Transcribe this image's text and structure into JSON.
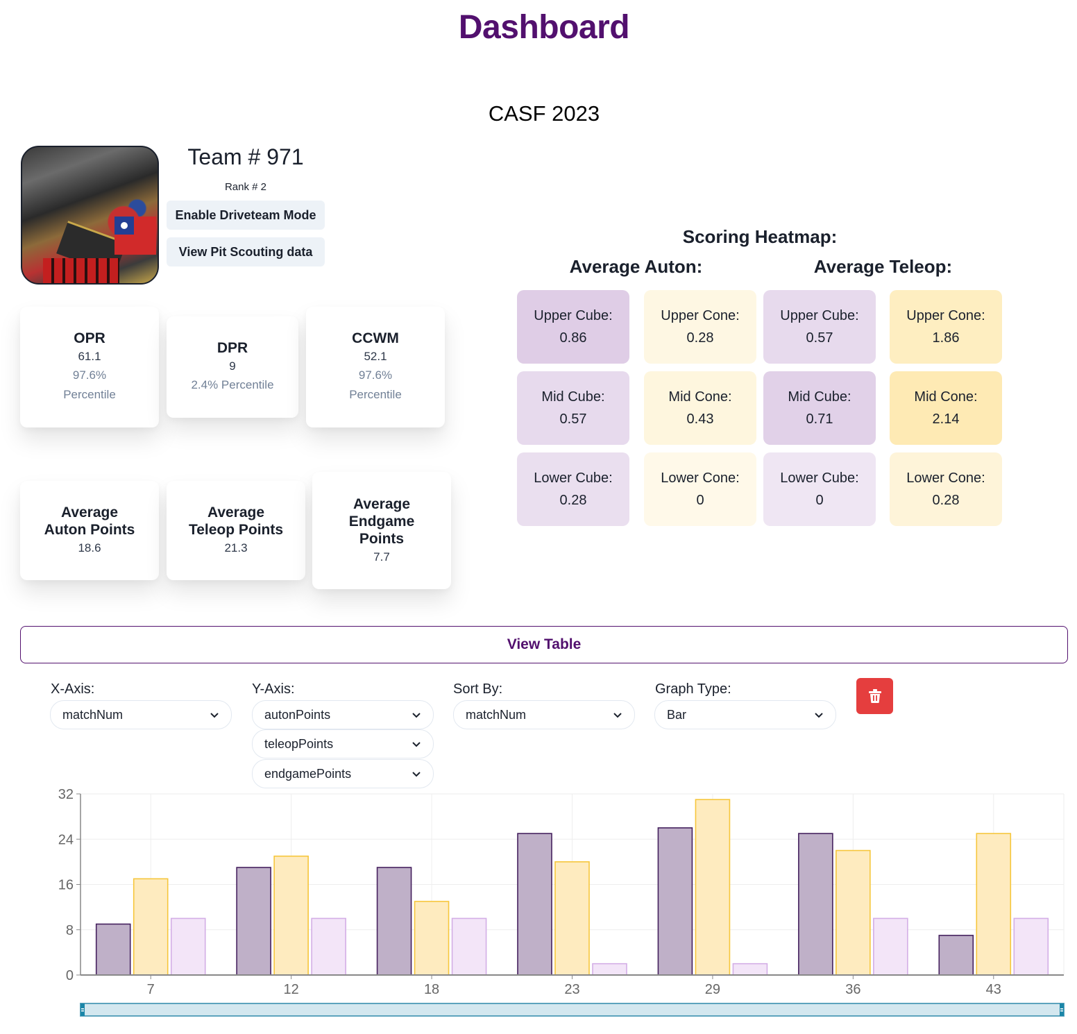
{
  "page": {
    "title": "Dashboard",
    "event": "CASF 2023"
  },
  "team": {
    "title": "Team # 971",
    "rank": "Rank # 2",
    "photo_alt": "team-robot-photo",
    "buttons": {
      "driveteam": "Enable Driveteam Mode",
      "pit": "View Pit Scouting data"
    }
  },
  "stats": [
    {
      "label": "OPR",
      "value": "61.1",
      "percentile": "97.6% Percentile"
    },
    {
      "label": "DPR",
      "value": "9",
      "percentile": "2.4% Percentile"
    },
    {
      "label": "CCWM",
      "value": "52.1",
      "percentile": "97.6% Percentile"
    }
  ],
  "averages": [
    {
      "label": "Average Auton Points",
      "value": "18.6"
    },
    {
      "label": "Average Teleop Points",
      "value": "21.3"
    },
    {
      "label": "Average Endgame Points",
      "value": "7.7"
    }
  ],
  "heatmap": {
    "title": "Scoring Heatmap:",
    "auton_title": "Average Auton:",
    "teleop_title": "Average Teleop:",
    "colors": {
      "cube": "#c9acd6",
      "cone": "#fde39b"
    },
    "auton": [
      {
        "label": "Upper Cube:",
        "value": "0.86",
        "type": "cube"
      },
      {
        "label": "Upper Cone:",
        "value": "0.28",
        "type": "cone"
      },
      {
        "label": "Mid Cube:",
        "value": "0.57",
        "type": "cube"
      },
      {
        "label": "Mid Cone:",
        "value": "0.43",
        "type": "cone"
      },
      {
        "label": "Lower Cube:",
        "value": "0.28",
        "type": "cube"
      },
      {
        "label": "Lower Cone:",
        "value": "0",
        "type": "cone"
      }
    ],
    "teleop": [
      {
        "label": "Upper Cube:",
        "value": "0.57",
        "type": "cube"
      },
      {
        "label": "Upper Cone:",
        "value": "1.86",
        "type": "cone"
      },
      {
        "label": "Mid Cube:",
        "value": "0.71",
        "type": "cube"
      },
      {
        "label": "Mid Cone:",
        "value": "2.14",
        "type": "cone"
      },
      {
        "label": "Lower Cube:",
        "value": "0",
        "type": "cube"
      },
      {
        "label": "Lower Cone:",
        "value": "0.28",
        "type": "cone"
      }
    ]
  },
  "view_table_label": "View Table",
  "graph_controls": {
    "x_axis": {
      "label": "X-Axis:",
      "value": "matchNum"
    },
    "y_axis": {
      "label": "Y-Axis:",
      "values": [
        "autonPoints",
        "teleopPoints",
        "endgamePoints"
      ]
    },
    "sort_by": {
      "label": "Sort By:",
      "value": "matchNum"
    },
    "graph_type": {
      "label": "Graph Type:",
      "value": "Bar"
    },
    "delete_icon": "trash-icon"
  },
  "chart_data": {
    "type": "bar",
    "title": "",
    "xlabel": "",
    "ylabel": "",
    "categories": [
      "7",
      "12",
      "18",
      "23",
      "29",
      "36",
      "43"
    ],
    "series": [
      {
        "name": "autonPoints",
        "values": [
          9,
          19,
          19,
          25,
          26,
          25,
          7
        ],
        "fill": "#bfb0c8",
        "stroke": "#45215e"
      },
      {
        "name": "teleopPoints",
        "values": [
          17,
          21,
          13,
          20,
          31,
          22,
          25
        ],
        "fill": "#feebbf",
        "stroke": "#f6c63c"
      },
      {
        "name": "endgamePoints",
        "values": [
          10,
          10,
          10,
          2,
          2,
          10,
          10
        ],
        "fill": "#f3e5f8",
        "stroke": "#d3aee6"
      }
    ],
    "yticks": [
      0,
      8,
      16,
      24,
      32
    ],
    "ylim": [
      0,
      32
    ],
    "grid": true,
    "legend": "none",
    "brush": {
      "start": "7",
      "end": "43"
    }
  }
}
